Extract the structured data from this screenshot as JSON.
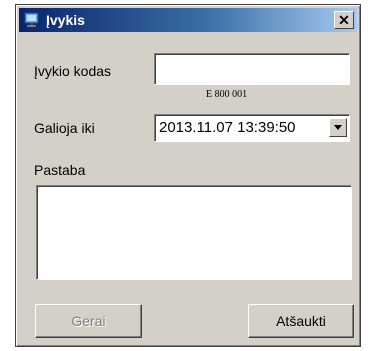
{
  "window": {
    "title": "Įvykis"
  },
  "colors": {
    "titlebar_start": "#0a246a",
    "titlebar_end": "#a6caf0",
    "face": "#d4d0c8"
  },
  "icons": {
    "app": "monitor-icon",
    "close": "close-icon",
    "dropdown": "chevron-down-icon"
  },
  "form": {
    "event_code": {
      "label": "Įvykio kodas",
      "value": "",
      "hint": "E 800 001"
    },
    "valid_until": {
      "label": "Galioja iki",
      "value": "2013.11.07 13:39:50"
    },
    "note": {
      "label": "Pastaba",
      "value": ""
    }
  },
  "buttons": {
    "ok": "Gerai",
    "cancel": "Atšaukti"
  }
}
